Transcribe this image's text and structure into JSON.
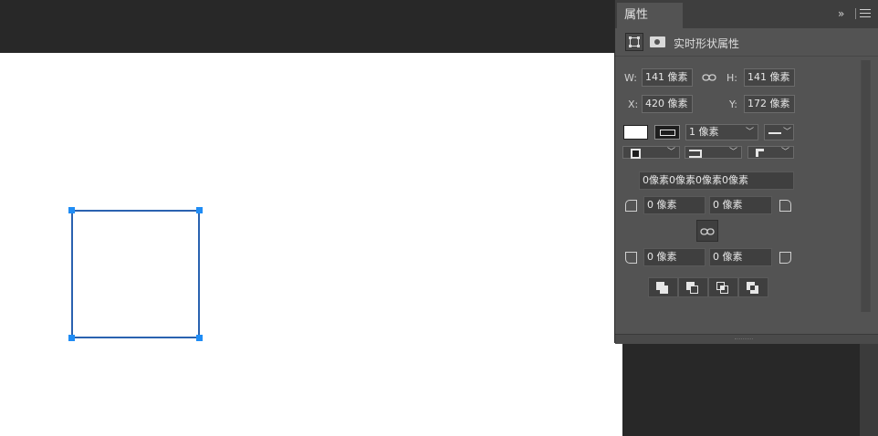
{
  "panel": {
    "tab_label": "属性",
    "expand_glyph": "»",
    "header_label": "实时形状属性"
  },
  "transform": {
    "w_label": "W:",
    "w_value": "141 像素",
    "h_label": "H:",
    "h_value": "141 像素",
    "x_label": "X:",
    "x_value": "420 像素",
    "y_label": "Y:",
    "y_value": "172 像素"
  },
  "appearance": {
    "fill_color": "#ffffff",
    "stroke_width_value": "1 像素"
  },
  "corners": {
    "combined_value": "0像素0像素0像素0像素",
    "top_left": "0 像素",
    "top_right": "0 像素",
    "bottom_left": "0 像素",
    "bottom_right": "0 像素"
  },
  "colors": {
    "selection": "#2a62b0",
    "handle": "#1f8cf5",
    "panel_bg": "#535353",
    "topbar_bg": "#282828"
  }
}
